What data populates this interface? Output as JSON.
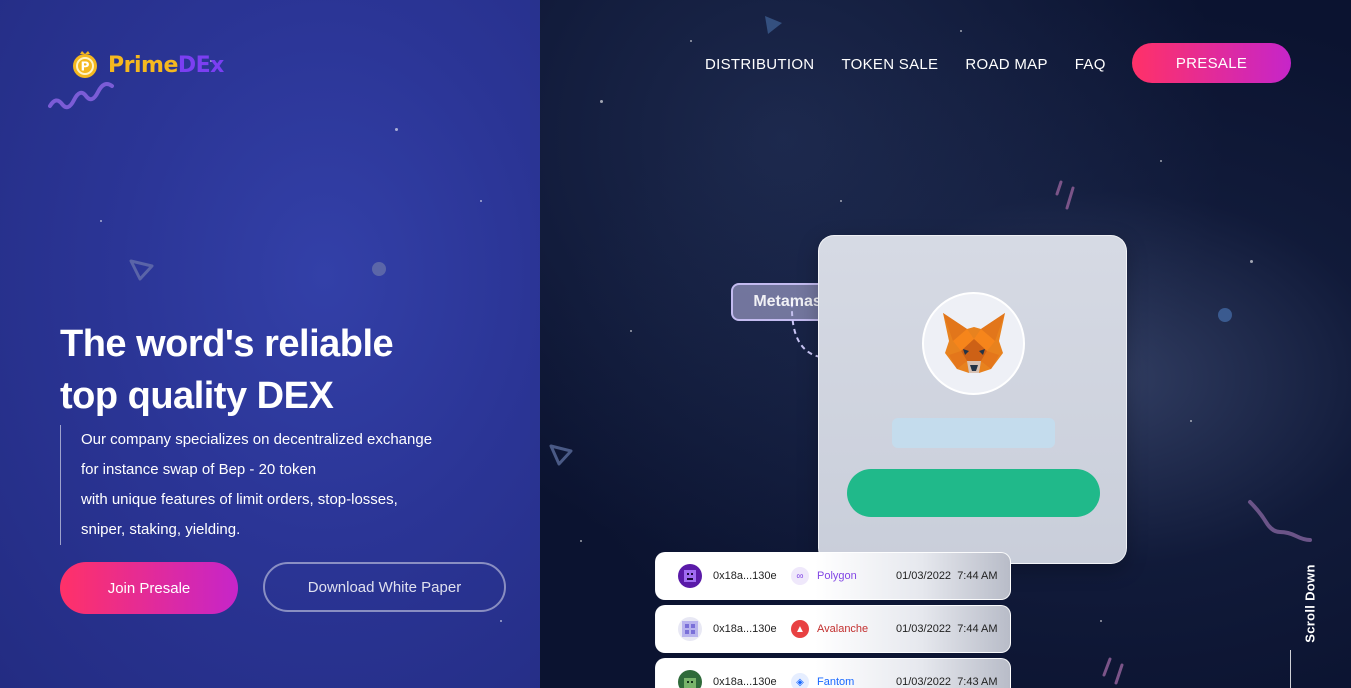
{
  "brand": {
    "name_part1": "Prime",
    "name_part2": "DEx"
  },
  "nav": {
    "items": [
      "DISTRIBUTION",
      "TOKEN SALE",
      "ROAD MAP",
      "FAQ"
    ],
    "cta": "PRESALE"
  },
  "hero": {
    "title_line1": "The word's reliable",
    "title_line2_prefix": "top quality ",
    "title_line2_bold": "DEX",
    "description": [
      "Our company specializes on decentralized exchange",
      "for instance swap of Bep - 20 token",
      "with unique features of limit orders, stop-losses,",
      "sniper, staking, yielding."
    ],
    "primary_button": "Join Presale",
    "secondary_button": "Download White Paper"
  },
  "wallet": {
    "tag": "Metamask"
  },
  "transactions": [
    {
      "address": "0x18a...130e",
      "chain": "Polygon",
      "chain_color": "#8247e5",
      "date": "01/03/2022",
      "time": "7:44 AM"
    },
    {
      "address": "0x18a...130e",
      "chain": "Avalanche",
      "chain_color": "#e84142",
      "date": "01/03/2022",
      "time": "7:44 AM"
    },
    {
      "address": "0x18a...130e",
      "chain": "Fantom",
      "chain_color": "#1969ff",
      "date": "01/03/2022",
      "time": "7:43 AM"
    }
  ],
  "scroll_label": "Scroll Down",
  "colors": {
    "accent_start": "#ff3168",
    "accent_end": "#c625c9",
    "connect_green": "#20b98a",
    "left_panel": "#2b3596"
  }
}
